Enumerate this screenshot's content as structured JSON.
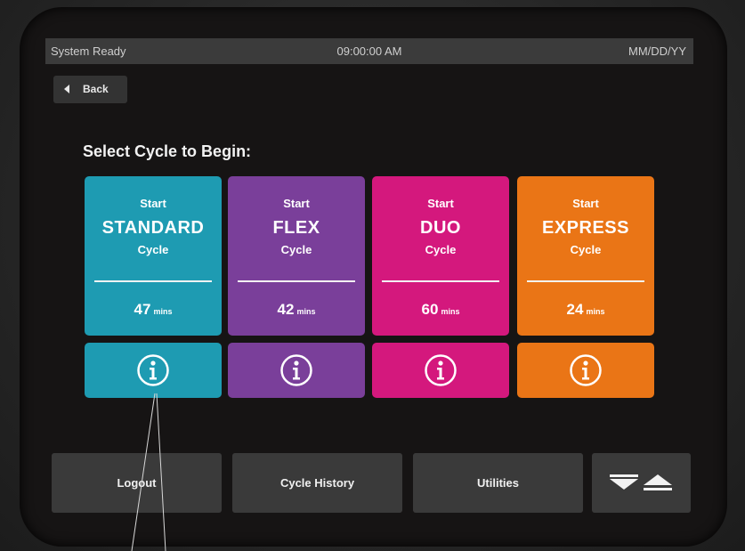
{
  "status": {
    "left": "System Ready",
    "time": "09:00:00 AM",
    "date": "MM/DD/YY"
  },
  "back_label": "Back",
  "heading": "Select Cycle to Begin:",
  "cycles": [
    {
      "start": "Start",
      "name": "STANDARD",
      "cycle": "Cycle",
      "mins": "47",
      "unit": "mins",
      "color": "#1e9bb2"
    },
    {
      "start": "Start",
      "name": "FLEX",
      "cycle": "Cycle",
      "mins": "42",
      "unit": "mins",
      "color": "#7a3f9a"
    },
    {
      "start": "Start",
      "name": "DUO",
      "cycle": "Cycle",
      "mins": "60",
      "unit": "mins",
      "color": "#d4187d"
    },
    {
      "start": "Start",
      "name": "EXPRESS",
      "cycle": "Cycle",
      "mins": "24",
      "unit": "mins",
      "color": "#ea7516"
    }
  ],
  "info_icon": "info-icon",
  "bottom": {
    "logout": "Logout",
    "history": "Cycle History",
    "utilities": "Utilities",
    "scroll_icon": "scroll-down-up-icon"
  }
}
